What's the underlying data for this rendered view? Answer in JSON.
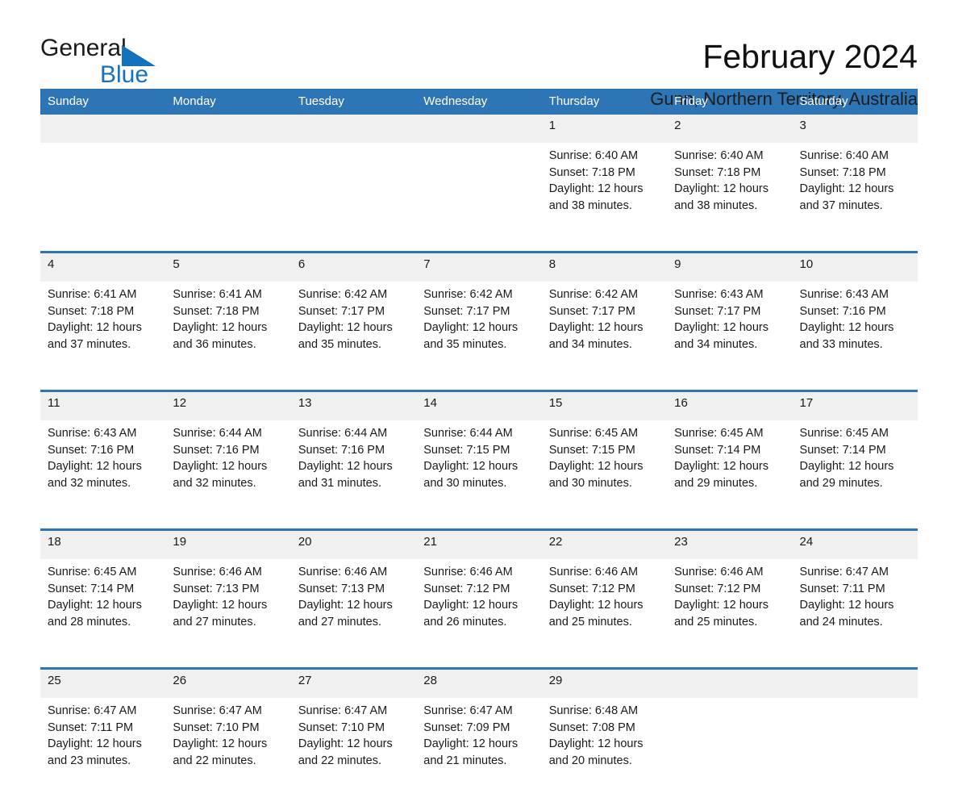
{
  "brand": {
    "line1": "General",
    "line2": "Blue",
    "triangle_color": "#1272bd",
    "triangle_icon": "brand-triangle-icon"
  },
  "header": {
    "month_title": "February 2024",
    "location": "Gunn, Northern Territory, Australia"
  },
  "theme": {
    "header_blue": "#2e75b6",
    "date_band": "#f0f0f0",
    "text": "#1a1a1a",
    "page_background": "#ffffff"
  },
  "weekdays": [
    "Sunday",
    "Monday",
    "Tuesday",
    "Wednesday",
    "Thursday",
    "Friday",
    "Saturday"
  ],
  "labels": {
    "sunrise_prefix": "Sunrise:",
    "sunset_prefix": "Sunset:",
    "daylight_prefix": "Daylight:"
  },
  "weeks": [
    {
      "days": [
        {
          "date": "",
          "lines": []
        },
        {
          "date": "",
          "lines": []
        },
        {
          "date": "",
          "lines": []
        },
        {
          "date": "",
          "lines": []
        },
        {
          "date": "1",
          "lines": [
            "Sunrise: 6:40 AM",
            "Sunset: 7:18 PM",
            "Daylight: 12 hours",
            "and 38 minutes."
          ]
        },
        {
          "date": "2",
          "lines": [
            "Sunrise: 6:40 AM",
            "Sunset: 7:18 PM",
            "Daylight: 12 hours",
            "and 38 minutes."
          ]
        },
        {
          "date": "3",
          "lines": [
            "Sunrise: 6:40 AM",
            "Sunset: 7:18 PM",
            "Daylight: 12 hours",
            "and 37 minutes."
          ]
        }
      ]
    },
    {
      "days": [
        {
          "date": "4",
          "lines": [
            "Sunrise: 6:41 AM",
            "Sunset: 7:18 PM",
            "Daylight: 12 hours",
            "and 37 minutes."
          ]
        },
        {
          "date": "5",
          "lines": [
            "Sunrise: 6:41 AM",
            "Sunset: 7:18 PM",
            "Daylight: 12 hours",
            "and 36 minutes."
          ]
        },
        {
          "date": "6",
          "lines": [
            "Sunrise: 6:42 AM",
            "Sunset: 7:17 PM",
            "Daylight: 12 hours",
            "and 35 minutes."
          ]
        },
        {
          "date": "7",
          "lines": [
            "Sunrise: 6:42 AM",
            "Sunset: 7:17 PM",
            "Daylight: 12 hours",
            "and 35 minutes."
          ]
        },
        {
          "date": "8",
          "lines": [
            "Sunrise: 6:42 AM",
            "Sunset: 7:17 PM",
            "Daylight: 12 hours",
            "and 34 minutes."
          ]
        },
        {
          "date": "9",
          "lines": [
            "Sunrise: 6:43 AM",
            "Sunset: 7:17 PM",
            "Daylight: 12 hours",
            "and 34 minutes."
          ]
        },
        {
          "date": "10",
          "lines": [
            "Sunrise: 6:43 AM",
            "Sunset: 7:16 PM",
            "Daylight: 12 hours",
            "and 33 minutes."
          ]
        }
      ]
    },
    {
      "days": [
        {
          "date": "11",
          "lines": [
            "Sunrise: 6:43 AM",
            "Sunset: 7:16 PM",
            "Daylight: 12 hours",
            "and 32 minutes."
          ]
        },
        {
          "date": "12",
          "lines": [
            "Sunrise: 6:44 AM",
            "Sunset: 7:16 PM",
            "Daylight: 12 hours",
            "and 32 minutes."
          ]
        },
        {
          "date": "13",
          "lines": [
            "Sunrise: 6:44 AM",
            "Sunset: 7:16 PM",
            "Daylight: 12 hours",
            "and 31 minutes."
          ]
        },
        {
          "date": "14",
          "lines": [
            "Sunrise: 6:44 AM",
            "Sunset: 7:15 PM",
            "Daylight: 12 hours",
            "and 30 minutes."
          ]
        },
        {
          "date": "15",
          "lines": [
            "Sunrise: 6:45 AM",
            "Sunset: 7:15 PM",
            "Daylight: 12 hours",
            "and 30 minutes."
          ]
        },
        {
          "date": "16",
          "lines": [
            "Sunrise: 6:45 AM",
            "Sunset: 7:14 PM",
            "Daylight: 12 hours",
            "and 29 minutes."
          ]
        },
        {
          "date": "17",
          "lines": [
            "Sunrise: 6:45 AM",
            "Sunset: 7:14 PM",
            "Daylight: 12 hours",
            "and 29 minutes."
          ]
        }
      ]
    },
    {
      "days": [
        {
          "date": "18",
          "lines": [
            "Sunrise: 6:45 AM",
            "Sunset: 7:14 PM",
            "Daylight: 12 hours",
            "and 28 minutes."
          ]
        },
        {
          "date": "19",
          "lines": [
            "Sunrise: 6:46 AM",
            "Sunset: 7:13 PM",
            "Daylight: 12 hours",
            "and 27 minutes."
          ]
        },
        {
          "date": "20",
          "lines": [
            "Sunrise: 6:46 AM",
            "Sunset: 7:13 PM",
            "Daylight: 12 hours",
            "and 27 minutes."
          ]
        },
        {
          "date": "21",
          "lines": [
            "Sunrise: 6:46 AM",
            "Sunset: 7:12 PM",
            "Daylight: 12 hours",
            "and 26 minutes."
          ]
        },
        {
          "date": "22",
          "lines": [
            "Sunrise: 6:46 AM",
            "Sunset: 7:12 PM",
            "Daylight: 12 hours",
            "and 25 minutes."
          ]
        },
        {
          "date": "23",
          "lines": [
            "Sunrise: 6:46 AM",
            "Sunset: 7:12 PM",
            "Daylight: 12 hours",
            "and 25 minutes."
          ]
        },
        {
          "date": "24",
          "lines": [
            "Sunrise: 6:47 AM",
            "Sunset: 7:11 PM",
            "Daylight: 12 hours",
            "and 24 minutes."
          ]
        }
      ]
    },
    {
      "days": [
        {
          "date": "25",
          "lines": [
            "Sunrise: 6:47 AM",
            "Sunset: 7:11 PM",
            "Daylight: 12 hours",
            "and 23 minutes."
          ]
        },
        {
          "date": "26",
          "lines": [
            "Sunrise: 6:47 AM",
            "Sunset: 7:10 PM",
            "Daylight: 12 hours",
            "and 22 minutes."
          ]
        },
        {
          "date": "27",
          "lines": [
            "Sunrise: 6:47 AM",
            "Sunset: 7:10 PM",
            "Daylight: 12 hours",
            "and 22 minutes."
          ]
        },
        {
          "date": "28",
          "lines": [
            "Sunrise: 6:47 AM",
            "Sunset: 7:09 PM",
            "Daylight: 12 hours",
            "and 21 minutes."
          ]
        },
        {
          "date": "29",
          "lines": [
            "Sunrise: 6:48 AM",
            "Sunset: 7:08 PM",
            "Daylight: 12 hours",
            "and 20 minutes."
          ]
        },
        {
          "date": "",
          "lines": []
        },
        {
          "date": "",
          "lines": []
        }
      ]
    }
  ]
}
